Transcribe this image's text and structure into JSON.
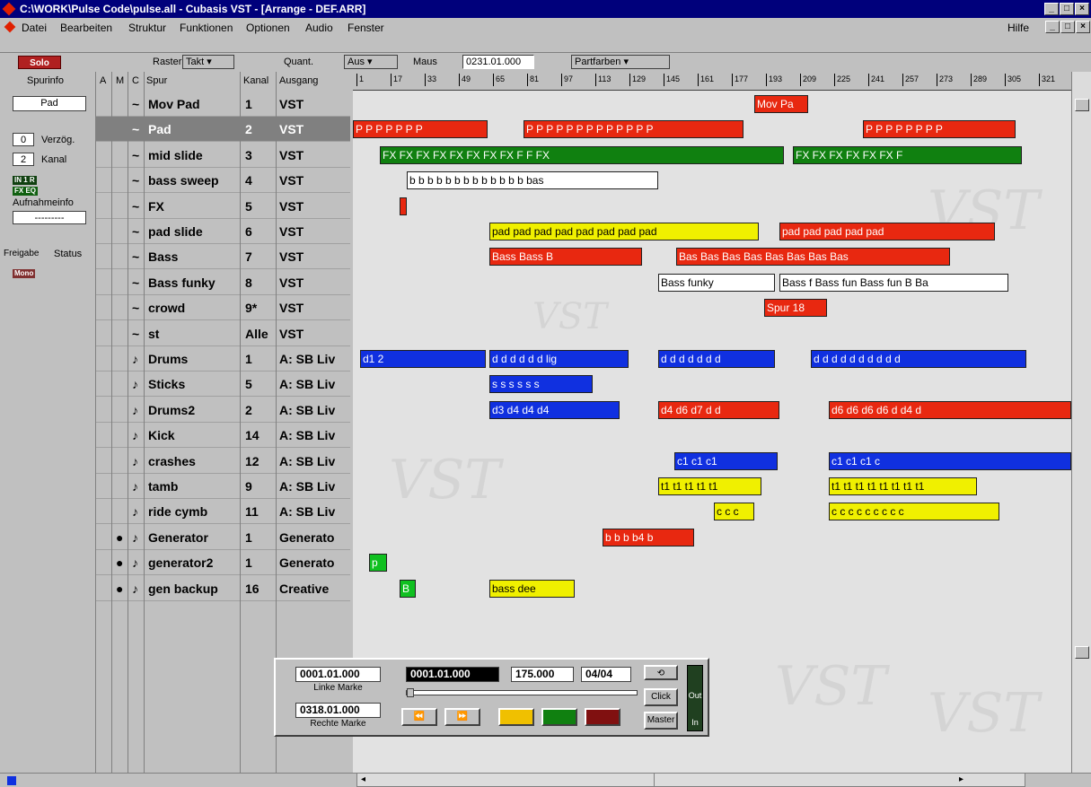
{
  "window": {
    "title": "C:\\WORK\\Pulse Code\\pulse.all - Cubasis VST - [Arrange - DEF.ARR]",
    "controls": [
      "_",
      "□",
      "×"
    ]
  },
  "menu": {
    "items": [
      "Datei",
      "Bearbeiten",
      "Struktur",
      "Funktionen",
      "Optionen",
      "Audio",
      "Fenster"
    ],
    "help": "Hilfe"
  },
  "toolbar": {
    "solo": "Solo",
    "raster_label": "Raster",
    "raster_value": "Takt",
    "quant_label": "Quant.",
    "quant_value": "Aus",
    "maus_label": "Maus",
    "maus_value": "0231.01.000",
    "color_value": "Partfarben"
  },
  "inspector": {
    "header": "Spurinfo",
    "track_name": "Pad",
    "delay_value": "0",
    "delay_label": "Verzög.",
    "channel_value": "2",
    "channel_label": "Kanal",
    "in_tag": "IN 1 R",
    "fx_tag": "FX EQ",
    "record_label": "Aufnahmeinfo",
    "record_value": "---------",
    "freigabe_label": "Freigabe",
    "status_label": "Status",
    "mono_tag": "Mono"
  },
  "tracklist": {
    "headers": {
      "a": "A",
      "m": "M",
      "c": "C",
      "track": "Spur",
      "channel": "Kanal",
      "output": "Ausgang"
    },
    "tracks": [
      {
        "icon": "~",
        "name": "Mov Pad",
        "channel": "1",
        "output": "VST"
      },
      {
        "icon": "~",
        "name": "Pad",
        "channel": "2",
        "output": "VST"
      },
      {
        "icon": "~",
        "name": "mid slide",
        "channel": "3",
        "output": "VST"
      },
      {
        "icon": "~",
        "name": "bass sweep",
        "channel": "4",
        "output": "VST"
      },
      {
        "icon": "~",
        "name": "FX",
        "channel": "5",
        "output": "VST"
      },
      {
        "icon": "~",
        "name": "pad slide",
        "channel": "6",
        "output": "VST"
      },
      {
        "icon": "~",
        "name": "Bass",
        "channel": "7",
        "output": "VST"
      },
      {
        "icon": "~",
        "name": "Bass funky",
        "channel": "8",
        "output": "VST"
      },
      {
        "icon": "~",
        "name": "crowd",
        "channel": "9*",
        "output": "VST"
      },
      {
        "icon": "~",
        "name": "st",
        "channel": "Alle",
        "output": "VST"
      },
      {
        "icon": "♪",
        "name": "Drums",
        "channel": "1",
        "output": "A: SB Liv"
      },
      {
        "icon": "♪",
        "name": "Sticks",
        "channel": "5",
        "output": "A: SB Liv"
      },
      {
        "icon": "♪",
        "name": "Drums2",
        "channel": "2",
        "output": "A: SB Liv"
      },
      {
        "icon": "♪",
        "name": "Kick",
        "channel": "14",
        "output": "A: SB Liv"
      },
      {
        "icon": "♪",
        "name": "crashes",
        "channel": "12",
        "output": "A: SB Liv"
      },
      {
        "icon": "♪",
        "name": "tamb",
        "channel": "9",
        "output": "A: SB Liv"
      },
      {
        "icon": "♪",
        "name": "ride cymb",
        "channel": "11",
        "output": "A: SB Liv"
      },
      {
        "icon": "♪",
        "name": "Generator",
        "channel": "1",
        "output": "Generato",
        "dot": "●"
      },
      {
        "icon": "♪",
        "name": "generator2",
        "channel": "1",
        "output": "Generato",
        "dot": "●"
      },
      {
        "icon": "♪",
        "name": "gen backup",
        "channel": "16",
        "output": "Creative",
        "dot": "●"
      }
    ]
  },
  "ruler": {
    "bars": [
      "1",
      "17",
      "33",
      "49",
      "65",
      "81",
      "97",
      "113",
      "129",
      "145",
      "161",
      "177",
      "193",
      "209",
      "225",
      "241",
      "257",
      "273",
      "289",
      "305",
      "321"
    ]
  },
  "parts": [
    {
      "row": 0,
      "label": "Mov Pa",
      "color": "red"
    },
    {
      "row": 1,
      "label": "P P P P P P P",
      "color": "red"
    },
    {
      "row": 1,
      "label": "P P P P P P P P P P P P P",
      "color": "red"
    },
    {
      "row": 1,
      "label": "P P P P P P P P",
      "color": "red"
    },
    {
      "row": 2,
      "label": "FX FX FX FX FX FX FX FX F F FX",
      "color": "darkgreen"
    },
    {
      "row": 2,
      "label": "FX FX FX FX FX FX F",
      "color": "darkgreen"
    },
    {
      "row": 3,
      "label": "b b b b b b b b b b b b b bas",
      "color": "white"
    },
    {
      "row": 4,
      "label": "",
      "color": "red"
    },
    {
      "row": 5,
      "label": "pad pad pad pad pad pad pad pad",
      "color": "yellow"
    },
    {
      "row": 5,
      "label": "pad pad pad pad pad",
      "color": "red"
    },
    {
      "row": 6,
      "label": "Bass Bass B",
      "color": "red"
    },
    {
      "row": 6,
      "label": "Bas Bas Bas Bas Bas Bas Bas Bas",
      "color": "red"
    },
    {
      "row": 7,
      "label": "Bass funky",
      "color": "white"
    },
    {
      "row": 7,
      "label": "Bass f Bass fun Bass fun B Ba",
      "color": "white"
    },
    {
      "row": 8,
      "label": "Spur 18",
      "color": "red"
    },
    {
      "row": 10,
      "label": "d1 2",
      "color": "blue"
    },
    {
      "row": 10,
      "label": "d d d d d d lig",
      "color": "blue"
    },
    {
      "row": 10,
      "label": "d d d d d d d",
      "color": "blue"
    },
    {
      "row": 10,
      "label": "d d d d d d d d d d",
      "color": "blue"
    },
    {
      "row": 11,
      "label": "s s s s s s",
      "color": "blue"
    },
    {
      "row": 12,
      "label": "d3 d4 d4 d4",
      "color": "blue"
    },
    {
      "row": 12,
      "label": "d4 d6 d7 d d",
      "color": "red"
    },
    {
      "row": 12,
      "label": "d6 d6 d6 d6 d d4 d",
      "color": "red"
    },
    {
      "row": 14,
      "label": "c1 c1 c1",
      "color": "blue"
    },
    {
      "row": 14,
      "label": "c1 c1 c1 c",
      "color": "blue"
    },
    {
      "row": 15,
      "label": "t1 t1 t1 t1 t1",
      "color": "yellow"
    },
    {
      "row": 15,
      "label": "t1 t1 t1 t1 t1 t1 t1 t1",
      "color": "yellow"
    },
    {
      "row": 16,
      "label": "c c c",
      "color": "yellow"
    },
    {
      "row": 16,
      "label": "c c c c c c c c c",
      "color": "yellow"
    },
    {
      "row": 17,
      "label": "b b b b4 b",
      "color": "red"
    },
    {
      "row": 18,
      "label": "p",
      "color": "green"
    },
    {
      "row": 19,
      "label": "B",
      "color": "green"
    },
    {
      "row": 19,
      "label": "bass dee",
      "color": "yellow"
    }
  ],
  "watermark": "VST",
  "transport": {
    "left_locator": "0001.01.000",
    "left_label": "Linke Marke",
    "right_locator": "0318.01.000",
    "right_label": "Rechte Marke",
    "position": "0001.01.000",
    "tempo": "175.000",
    "signature": "04/04",
    "click": "Click",
    "master": "Master",
    "out": "Out",
    "in": "In"
  }
}
